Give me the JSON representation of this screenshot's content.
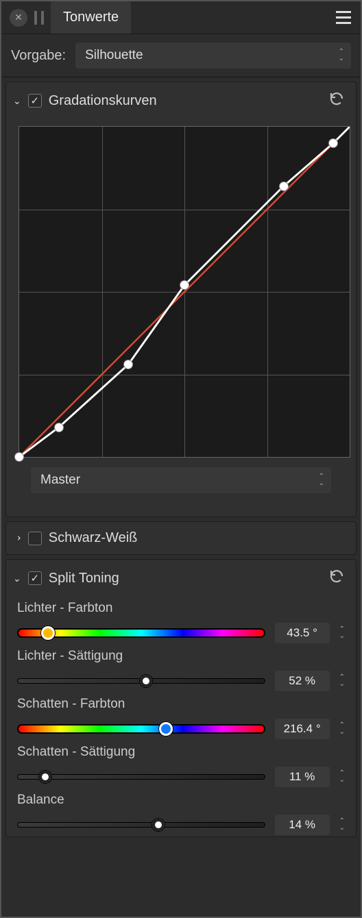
{
  "header": {
    "tab_title": "Tonwerte"
  },
  "preset": {
    "label": "Vorgabe:",
    "value": "Silhouette"
  },
  "curves": {
    "title": "Gradationskurven",
    "enabled": true,
    "channel": "Master",
    "points": [
      {
        "x": 0.0,
        "y": 0.0
      },
      {
        "x": 0.12,
        "y": 0.09
      },
      {
        "x": 0.33,
        "y": 0.28
      },
      {
        "x": 0.5,
        "y": 0.52
      },
      {
        "x": 0.8,
        "y": 0.82
      },
      {
        "x": 0.95,
        "y": 0.95
      }
    ]
  },
  "bw": {
    "title": "Schwarz-Weiß",
    "enabled": false
  },
  "split": {
    "title": "Split Toning",
    "enabled": true,
    "sliders": {
      "hi_hue": {
        "label": "Lichter - Farbton",
        "value": "43.5 °",
        "pos": 12.1,
        "type": "hue",
        "color": "#ffba00"
      },
      "hi_sat": {
        "label": "Lichter - Sättigung",
        "value": "52 %",
        "pos": 52.0,
        "type": "plain"
      },
      "sh_hue": {
        "label": "Schatten - Farbton",
        "value": "216.4 °",
        "pos": 60.1,
        "type": "hue",
        "color": "#1478ff"
      },
      "sh_sat": {
        "label": "Schatten - Sättigung",
        "value": "11 %",
        "pos": 11.0,
        "type": "plain"
      },
      "balance": {
        "label": "Balance",
        "value": "14 %",
        "pos": 57.0,
        "type": "plain"
      }
    }
  }
}
